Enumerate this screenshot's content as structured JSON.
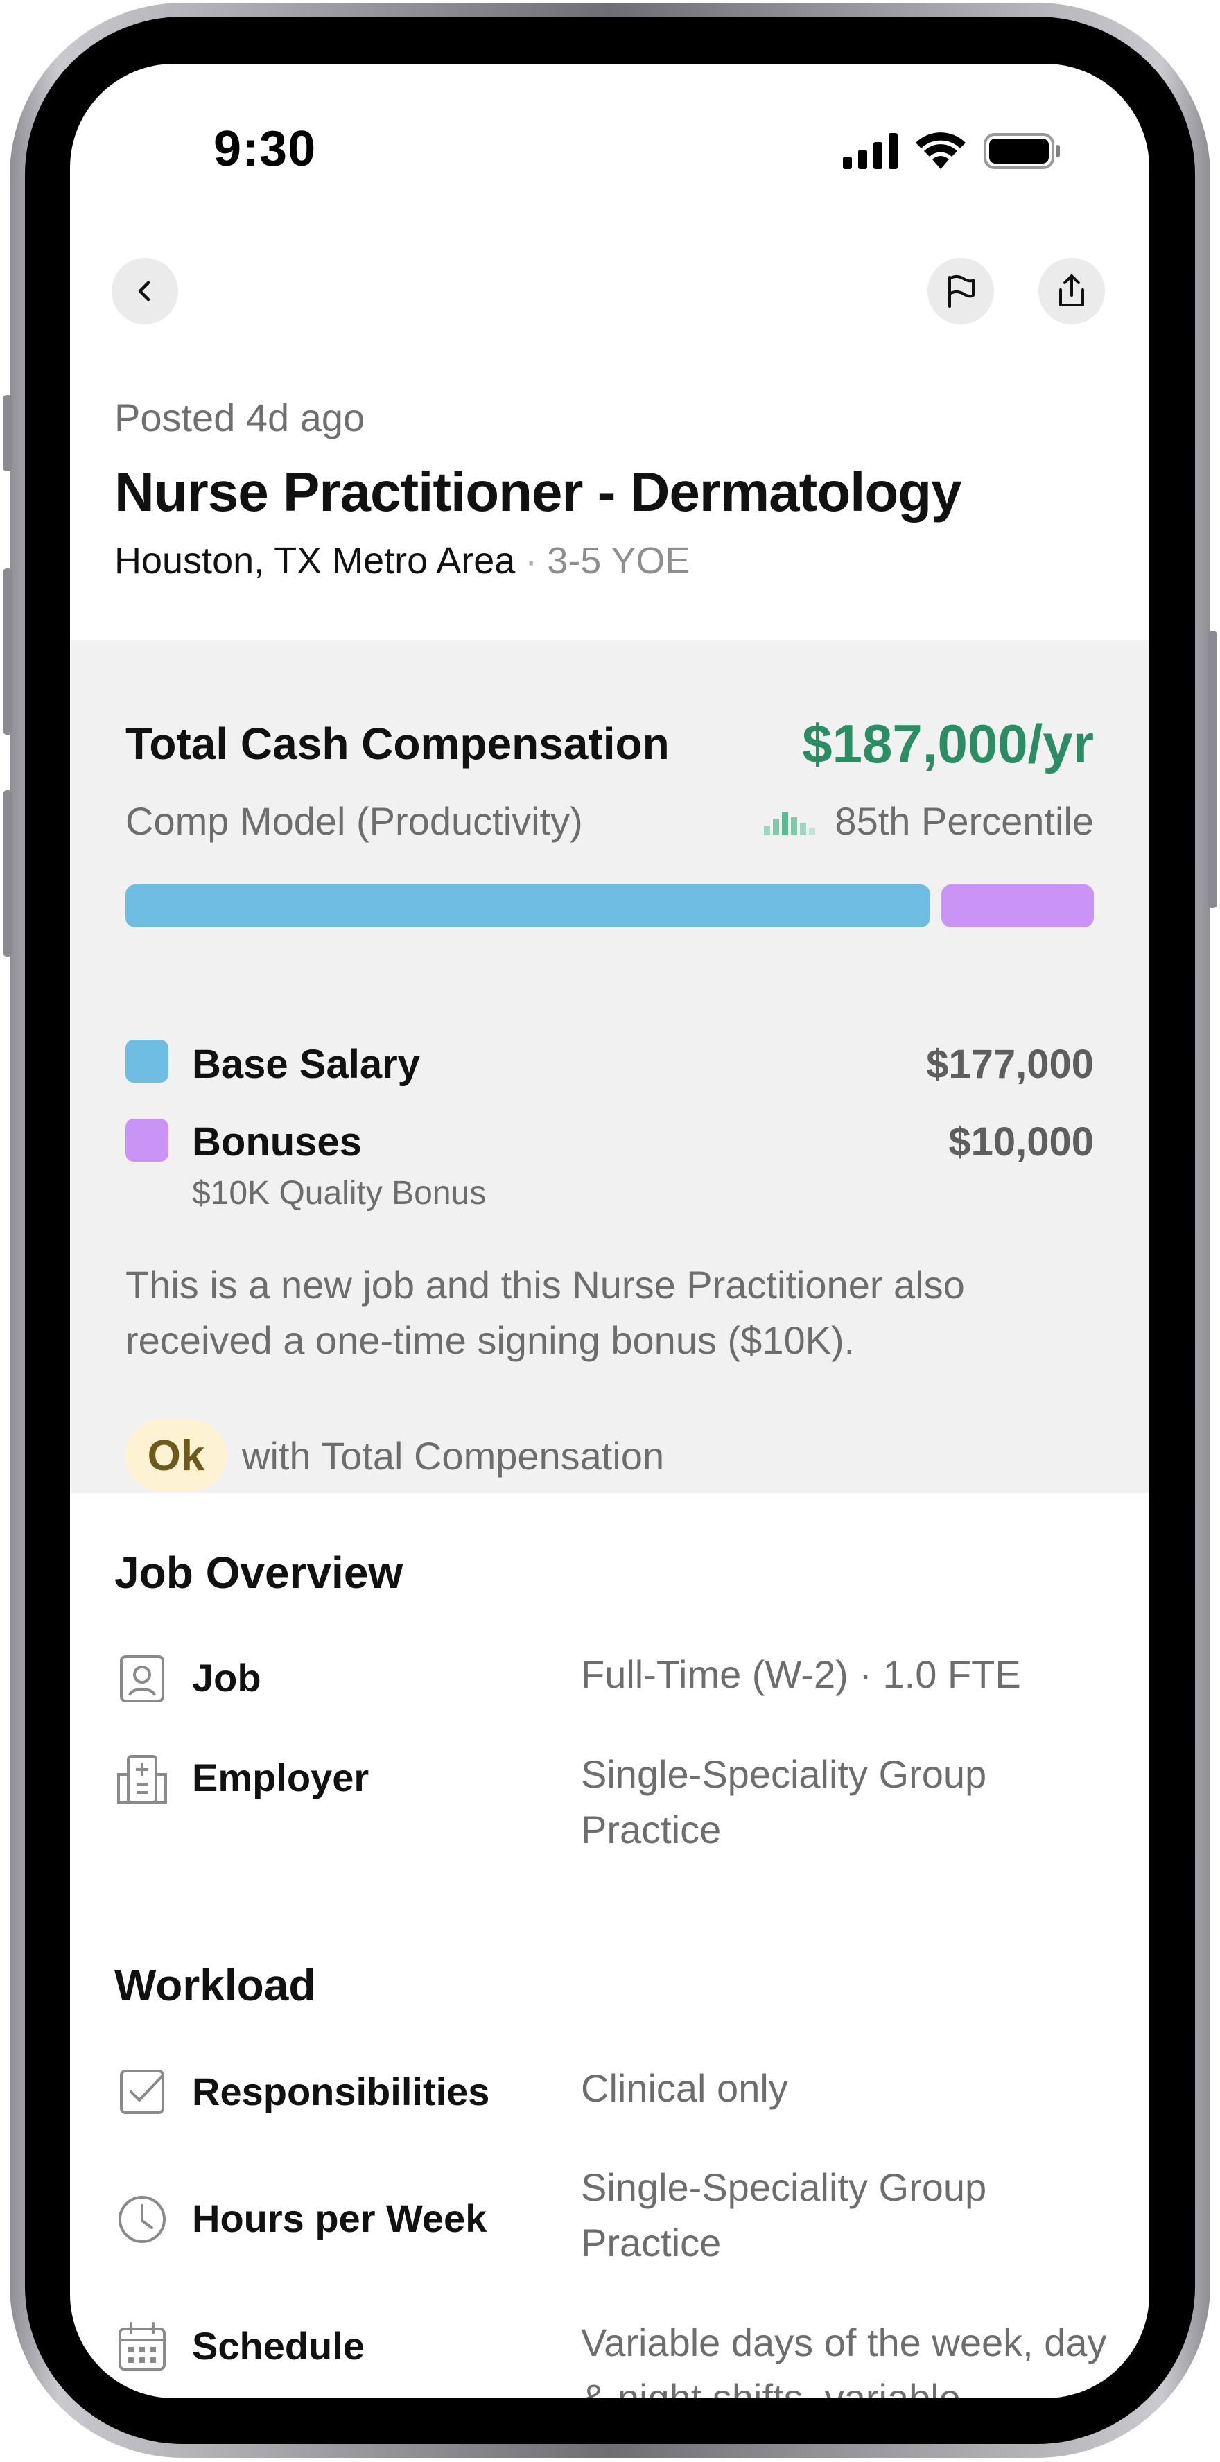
{
  "status_bar": {
    "time": "9:30"
  },
  "nav": {
    "back_icon": "chevron-left-icon",
    "flag_icon": "flag-icon",
    "share_icon": "share-icon"
  },
  "job": {
    "posted": "Posted 4d ago",
    "title": "Nurse Practitioner - Dermatology",
    "location": "Houston, TX Metro Area",
    "separator": "·",
    "experience": "3-5 YOE"
  },
  "compensation": {
    "title": "Total Cash Compensation",
    "total": "$187,000/yr",
    "model": "Comp Model (Productivity)",
    "percentile": "85th Percentile",
    "breakdown": [
      {
        "label": "Base Salary",
        "value": "$177,000",
        "amount": 177000,
        "color": "#6fbde3",
        "sub": ""
      },
      {
        "label": "Bonuses",
        "value": "$10,000",
        "amount": 10000,
        "color": "#c994f5",
        "sub": "$10K Quality Bonus"
      }
    ],
    "note": "This is a new job and this Nurse Practitioner also received a one-time signing bonus ($10K).",
    "rating_badge": "Ok",
    "rating_text": "with Total Compensation"
  },
  "job_overview": {
    "heading": "Job Overview",
    "rows": [
      {
        "icon": "person-badge-icon",
        "label": "Job",
        "value": "Full-Time (W-2) · 1.0 FTE"
      },
      {
        "icon": "hospital-icon",
        "label": "Employer",
        "value": "Single-Speciality Group Practice"
      }
    ]
  },
  "workload": {
    "heading": "Workload",
    "rows": [
      {
        "icon": "checkbox-icon",
        "label": "Responsibilities",
        "value": "Clinical only"
      },
      {
        "icon": "clock-icon",
        "label": "Hours per Week",
        "value": "Single-Speciality Group Practice"
      },
      {
        "icon": "calendar-icon",
        "label": "Schedule",
        "value": "Variable days of the week, day & night shifts, variable"
      }
    ]
  },
  "colors": {
    "accent_green": "#2c8c63",
    "base_salary": "#6fbde3",
    "bonuses": "#c994f5",
    "ok_badge_bg": "#fdf2d2"
  }
}
